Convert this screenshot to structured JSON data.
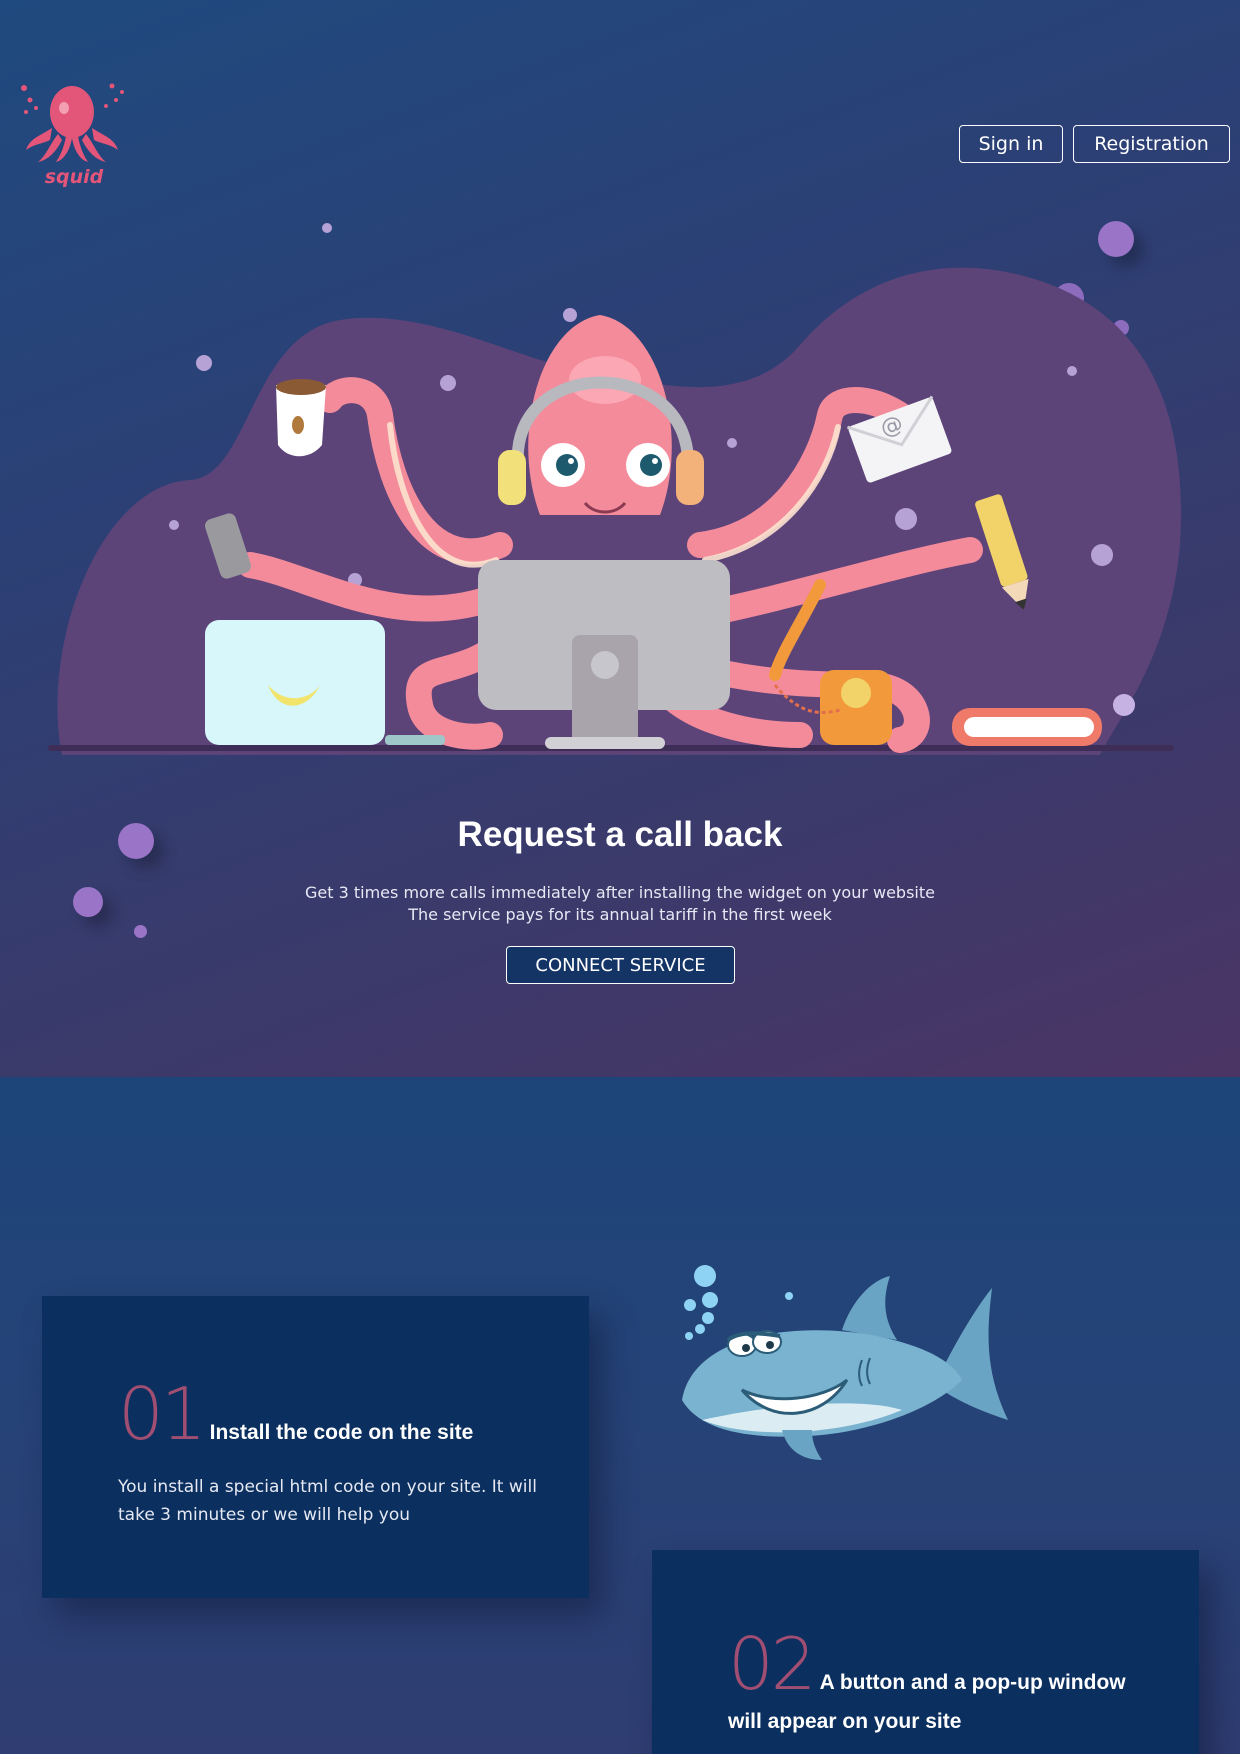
{
  "brand": {
    "logo_text": "squid",
    "logo_color": "#e4557a"
  },
  "nav": {
    "signin_label": "Sign in",
    "register_label": "Registration"
  },
  "hero": {
    "title": "Request a call back",
    "subtitle_line1": "Get 3 times more calls immediately after installing the widget on your website",
    "subtitle_line2": "The service pays for its annual tariff in the first week",
    "cta_label": "CONNECT SERVICE"
  },
  "steps": [
    {
      "number": "01",
      "title": "Install the code on the site",
      "description": "You install a special html code on your site. It will take 3 minutes or we will help you"
    },
    {
      "number": "02",
      "title": "A button and a pop-up window will appear on your site"
    }
  ],
  "colors": {
    "accent_pink": "#f48b9b",
    "step_number": "#a04e72",
    "card_bg": "#0b2f5e",
    "blob_purple": "#5c4479"
  },
  "icons": {
    "illustration": "octopus-at-computer-illustration",
    "shark": "shark-illustration"
  }
}
